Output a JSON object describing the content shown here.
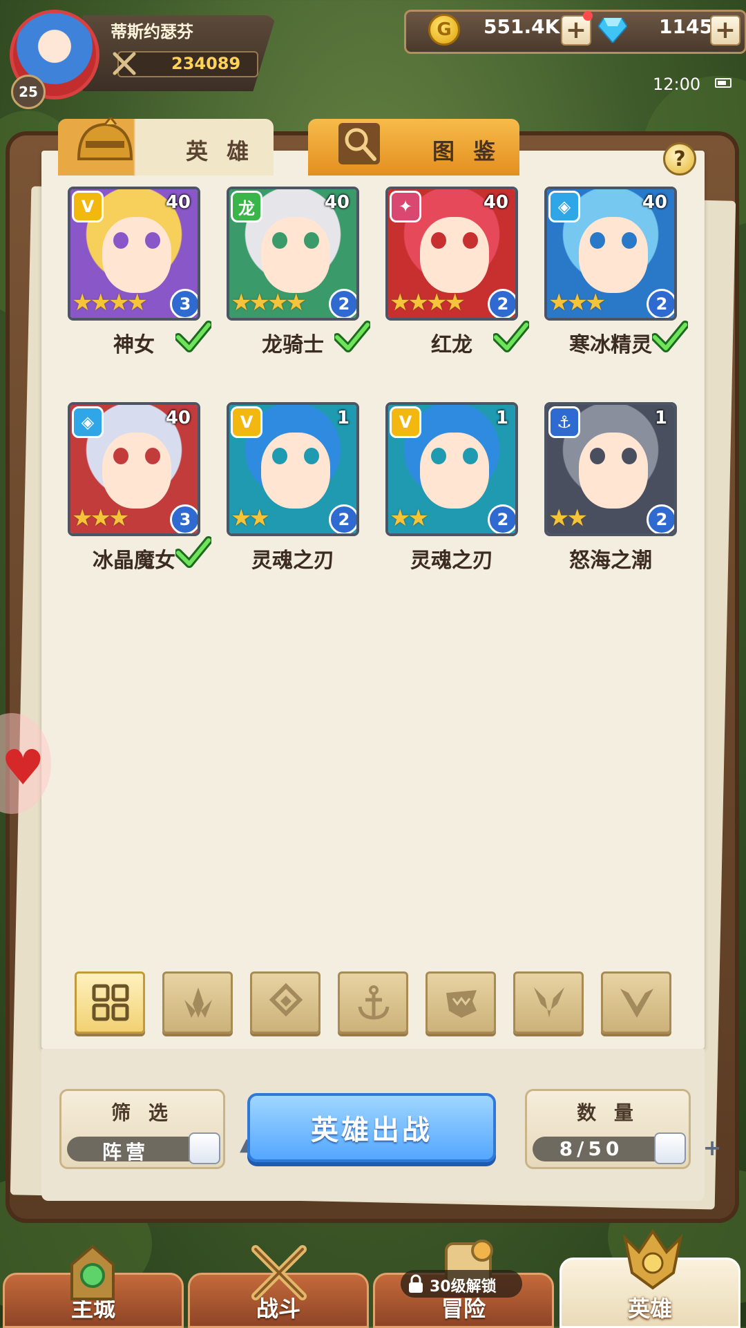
{
  "player": {
    "name": "蒂斯约瑟芬",
    "level": "25",
    "power": "234089"
  },
  "currency": {
    "gold": "551.4K",
    "gems": "1145"
  },
  "status": {
    "time": "12:00"
  },
  "tabs": [
    {
      "label": "英 雄",
      "icon": "helmet-icon"
    },
    {
      "label": "图 鉴",
      "icon": "magnifier-icon"
    }
  ],
  "help_label": "?",
  "heroes": [
    {
      "name": "神女",
      "level": "40",
      "stars": "★★★★",
      "badge": "3",
      "checked": true,
      "class_color": "#f2b80f",
      "class_glyph": "V"
    },
    {
      "name": "龙骑士",
      "level": "40",
      "stars": "★★★★",
      "badge": "2",
      "checked": true,
      "class_color": "#39b54a",
      "class_glyph": "龙"
    },
    {
      "name": "红龙",
      "level": "40",
      "stars": "★★★★",
      "badge": "2",
      "checked": true,
      "class_color": "#d94870",
      "class_glyph": "✦"
    },
    {
      "name": "寒冰精灵",
      "level": "40",
      "stars": "★★★",
      "badge": "2",
      "checked": true,
      "class_color": "#2ea6e8",
      "class_glyph": "◈"
    },
    {
      "name": "冰晶魔女",
      "level": "40",
      "stars": "★★★",
      "badge": "3",
      "checked": true,
      "class_color": "#2ea6e8",
      "class_glyph": "◈"
    },
    {
      "name": "灵魂之刃",
      "level": "1",
      "stars": "★★",
      "badge": "2",
      "checked": false,
      "class_color": "#f2b80f",
      "class_glyph": "V"
    },
    {
      "name": "灵魂之刃",
      "level": "1",
      "stars": "★★",
      "badge": "2",
      "checked": false,
      "class_color": "#f2b80f",
      "class_glyph": "V"
    },
    {
      "name": "怒海之潮",
      "level": "1",
      "stars": "★★",
      "badge": "2",
      "checked": false,
      "class_color": "#2f6ad0",
      "class_glyph": "⚓"
    }
  ],
  "faction_filters": [
    "all-grid-icon",
    "flame-icon",
    "diamond-icon",
    "anchor-icon",
    "dragon-icon",
    "fox-icon",
    "wing-icon"
  ],
  "filter": {
    "title": "筛 选",
    "value": "阵营"
  },
  "deploy_label": "英雄出战",
  "quantity": {
    "title": "数 量",
    "value": "8/50"
  },
  "nav": [
    {
      "label": "主城",
      "icon": "castle-icon"
    },
    {
      "label": "战斗",
      "icon": "crossed-swords-icon"
    },
    {
      "label": "冒险",
      "icon": "scroll-icon"
    },
    {
      "label": "英雄",
      "icon": "hero-crest-icon"
    }
  ],
  "lock_text": "30级解锁",
  "colors": {
    "accent_gold": "#f6c43a",
    "deploy_blue": "#54a7ff",
    "board_brown": "#7a5435"
  }
}
